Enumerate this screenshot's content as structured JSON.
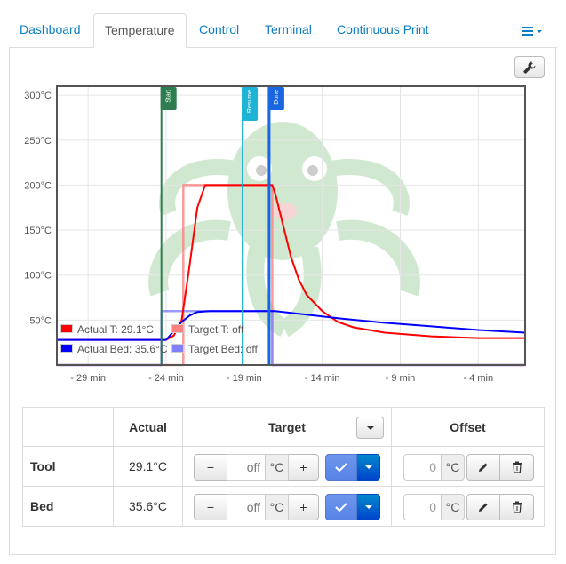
{
  "tabs": [
    {
      "label": "Dashboard",
      "active": false
    },
    {
      "label": "Temperature",
      "active": true
    },
    {
      "label": "Control",
      "active": false
    },
    {
      "label": "Terminal",
      "active": false
    },
    {
      "label": "Continuous Print",
      "active": false
    }
  ],
  "icons": {
    "menu": "hamburger-menu-icon",
    "wrench": "wrench-icon",
    "pencil": "pencil-icon",
    "trash": "trash-icon",
    "check": "check-icon",
    "caret": "caret-down-icon"
  },
  "colors": {
    "accent": "#0b7dc1",
    "actual_tool": "#ff0000",
    "target_tool": "#ff8080",
    "actual_bed": "#0000ff",
    "target_bed": "#8080ff",
    "start_marker": "#2e7d4f",
    "resume_marker": "#1fb3d6",
    "done_marker": "#1a66e0"
  },
  "chart_data": {
    "type": "line",
    "title": "",
    "xlabel": "",
    "ylabel": "",
    "x_unit": "minutes relative to now",
    "xlim": [
      -31,
      -1
    ],
    "ylim": [
      0,
      310
    ],
    "x_ticks": [
      -29,
      -24,
      -19,
      -14,
      -9,
      -4
    ],
    "x_tick_labels": [
      "- 29 min",
      "- 24 min",
      "- 19 min",
      "- 14 min",
      "- 9 min",
      "- 4 min"
    ],
    "y_ticks": [
      50,
      100,
      150,
      200,
      250,
      300
    ],
    "y_tick_labels": [
      "50°C",
      "100°C",
      "150°C",
      "200°C",
      "250°C",
      "300°C"
    ],
    "grid": true,
    "legend_placement": "bottom-left",
    "series": [
      {
        "name": "Actual T: 29.1°C",
        "color": "#ff0000",
        "x": [
          -31,
          -24.3,
          -24,
          -23.5,
          -23,
          -22.5,
          -22,
          -21.5,
          -20.5,
          -19,
          -17.2,
          -17,
          -16.5,
          -16,
          -15.5,
          -15,
          -14,
          -13,
          -12,
          -10,
          -7,
          -4,
          -1
        ],
        "y": [
          28,
          28,
          28,
          33,
          50,
          110,
          175,
          200,
          200,
          200,
          200,
          190,
          155,
          120,
          95,
          78,
          60,
          48,
          42,
          36,
          32,
          30,
          30
        ]
      },
      {
        "name": "Target T: off",
        "color": "#ff8080",
        "x": [
          -31,
          -22.9,
          -22.9,
          -17.2,
          -17.2,
          -1
        ],
        "y": [
          0,
          0,
          200,
          200,
          0,
          0
        ]
      },
      {
        "name": "Actual Bed: 35.6°C",
        "color": "#0000ff",
        "x": [
          -31,
          -24.3,
          -24,
          -23.5,
          -23,
          -22.5,
          -22,
          -21.2,
          -20,
          -17.2,
          -17,
          -15,
          -13,
          -10,
          -7,
          -4,
          -1
        ],
        "y": [
          28,
          28,
          28,
          38,
          48,
          55,
          59,
          60,
          60,
          60,
          60,
          56,
          52,
          47,
          43,
          39,
          36
        ]
      },
      {
        "name": "Target Bed: off",
        "color": "#8080ff",
        "x": [
          -31,
          -24.3,
          -24.3,
          -17.2,
          -17.2,
          -1
        ],
        "y": [
          0,
          0,
          60,
          60,
          0,
          0
        ]
      }
    ],
    "markers": [
      {
        "label": "Start",
        "x": -24.3,
        "color": "#2e7d4f"
      },
      {
        "label": "Resume",
        "x": -19.1,
        "color": "#1fb3d6"
      },
      {
        "label": "Done",
        "x": -17.4,
        "color": "#1a66e0"
      }
    ]
  },
  "table": {
    "headers": {
      "actual": "Actual",
      "target": "Target",
      "offset": "Offset"
    },
    "rows": [
      {
        "label": "Tool",
        "actual": "29.1°C",
        "target_placeholder": "off",
        "offset_value": "0"
      },
      {
        "label": "Bed",
        "actual": "35.6°C",
        "target_placeholder": "off",
        "offset_value": "0"
      }
    ],
    "unit": "°C",
    "minus": "−",
    "plus": "+"
  }
}
